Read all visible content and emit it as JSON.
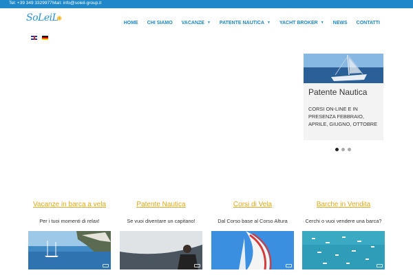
{
  "topbar": {
    "tel": "Tel: +39 349 3329977",
    "mail": "Mail: info@soleil-group.it"
  },
  "brand": {
    "logo_text": "SoLeiL",
    "accent": "#1e88c8",
    "gold": "#e0a81a"
  },
  "languages": [
    {
      "code": "en",
      "icon": "uk-flag-icon"
    },
    {
      "code": "de",
      "icon": "germany-flag-icon"
    }
  ],
  "nav": [
    {
      "label": "HOME",
      "dropdown": false
    },
    {
      "label": "CHI SIAMO",
      "dropdown": false
    },
    {
      "label": "VACANZE",
      "dropdown": true
    },
    {
      "label": "PATENTE NAUTICA",
      "dropdown": true
    },
    {
      "label": "YACHT BROKER",
      "dropdown": true
    },
    {
      "label": "NEWS",
      "dropdown": false
    },
    {
      "label": "CONTATTI",
      "dropdown": false
    }
  ],
  "slide_card": {
    "title": "Patente Nautica",
    "text": "CORSI ON-LINE E IN PRESENZA FEBBRAIO, APRILE, GIUGNO, OTTOBRE",
    "dots": 3,
    "active_dot": 0
  },
  "features": [
    {
      "title": "Vacanze in barca a vela",
      "subtitle": "Per i tuoi momenti di relax!"
    },
    {
      "title": "Patente Nautica",
      "subtitle": "Se vuoi diventare un capitano!"
    },
    {
      "title": "Corsi di Vela",
      "subtitle": "Dal Corso base al Corso Altura"
    },
    {
      "title": "Barche in Vendita",
      "subtitle": "Cerchi o vuoi vendere una barca?"
    }
  ]
}
